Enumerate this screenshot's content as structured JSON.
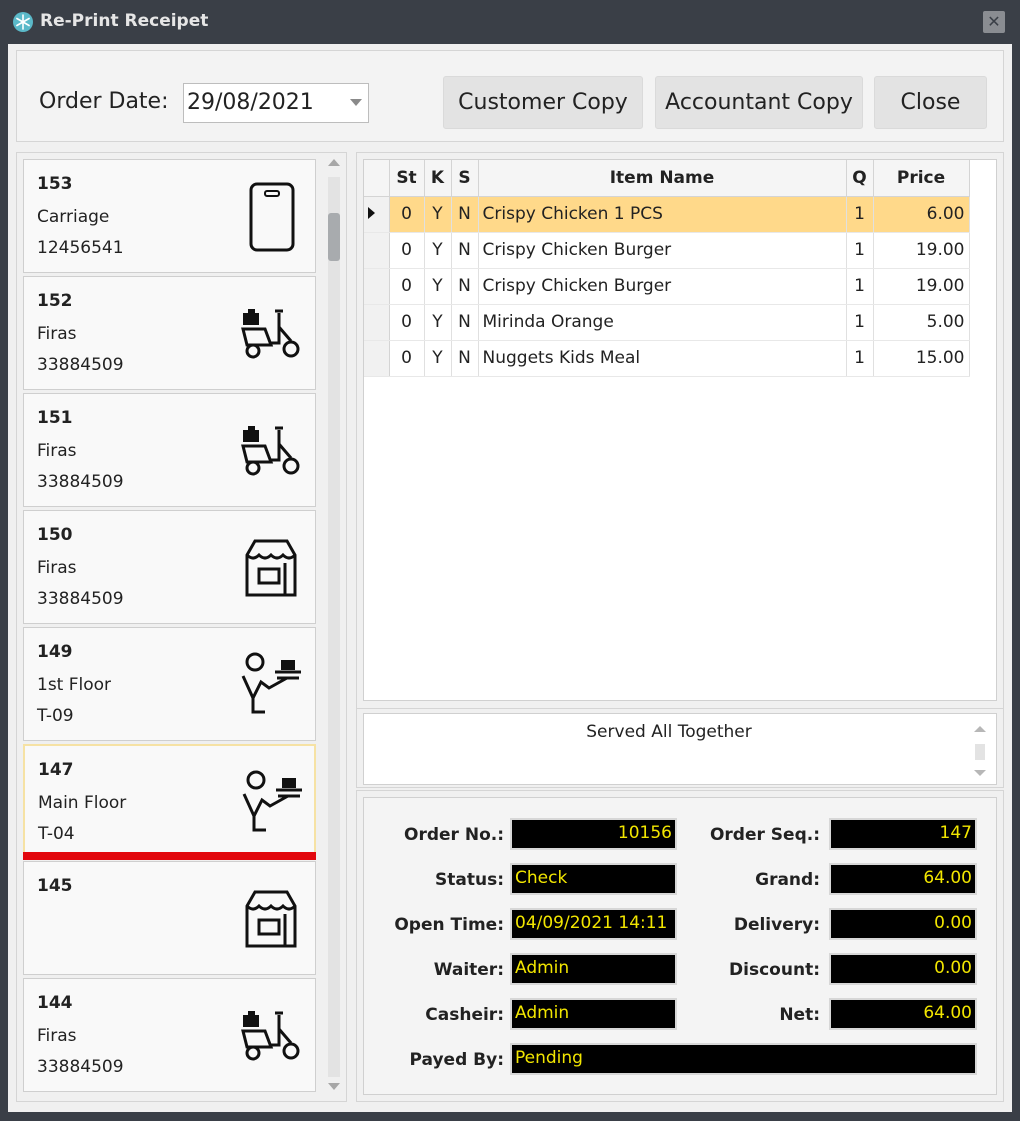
{
  "window": {
    "title": "Re-Print Receipet",
    "app_icon": "snowflake-icon",
    "close_glyph": "✕"
  },
  "toolbar": {
    "order_date_label": "Order Date:",
    "order_date_value": "29/08/2021",
    "customer_copy": "Customer Copy",
    "accountant_copy": "Accountant Copy",
    "close": "Close"
  },
  "orders": [
    {
      "number": "153",
      "line1": "Carriage",
      "line2": "12456541",
      "icon": "phone-icon"
    },
    {
      "number": "152",
      "line1": "Firas",
      "line2": "33884509",
      "icon": "delivery-scooter-icon"
    },
    {
      "number": "151",
      "line1": "Firas",
      "line2": "33884509",
      "icon": "delivery-scooter-icon"
    },
    {
      "number": "150",
      "line1": "Firas",
      "line2": "33884509",
      "icon": "takeaway-store-icon"
    },
    {
      "number": "149",
      "line1": "1st Floor",
      "line2": "T-09",
      "icon": "waiter-icon"
    },
    {
      "number": "147",
      "line1": "Main Floor",
      "line2": "T-04",
      "icon": "waiter-icon",
      "selected": true
    },
    {
      "number": "145",
      "line1": "",
      "line2": "",
      "icon": "takeaway-store-icon"
    },
    {
      "number": "144",
      "line1": "Firas",
      "line2": "33884509",
      "icon": "delivery-scooter-icon"
    }
  ],
  "items_grid": {
    "headers": {
      "st": "St",
      "k": "K",
      "s": "S",
      "name": "Item Name",
      "q": "Q",
      "price": "Price"
    },
    "rows": [
      {
        "st": "0",
        "k": "Y",
        "s": "N",
        "name": "Crispy Chicken 1 PCS",
        "q": "1",
        "price": "6.00"
      },
      {
        "st": "0",
        "k": "Y",
        "s": "N",
        "name": "Crispy Chicken Burger",
        "q": "1",
        "price": "19.00"
      },
      {
        "st": "0",
        "k": "Y",
        "s": "N",
        "name": "Crispy Chicken Burger",
        "q": "1",
        "price": "19.00"
      },
      {
        "st": "0",
        "k": "Y",
        "s": "N",
        "name": "Mirinda Orange",
        "q": "1",
        "price": "5.00"
      },
      {
        "st": "0",
        "k": "Y",
        "s": "N",
        "name": "Nuggets Kids Meal",
        "q": "1",
        "price": "15.00"
      }
    ],
    "active_row": 0
  },
  "note": "Served All Together",
  "details": {
    "order_no_label": "Order No.:",
    "order_no": "10156",
    "order_seq_label": "Order Seq.:",
    "order_seq": "147",
    "status_label": "Status:",
    "status": "Check",
    "grand_label": "Grand:",
    "grand": "64.00",
    "open_time_label": "Open Time:",
    "open_time": "04/09/2021 14:11",
    "delivery_label": "Delivery:",
    "delivery": "0.00",
    "waiter_label": "Waiter:",
    "waiter": "Admin",
    "discount_label": "Discount:",
    "discount": "0.00",
    "cashier_label": "Casheir:",
    "cashier": "Admin",
    "net_label": "Net:",
    "net": "64.00",
    "payed_by_label": "Payed By:",
    "payed_by": "Pending"
  },
  "colors": {
    "selected_row": "#ffd98a",
    "selection_bar": "#e2070d",
    "value_text": "#f2e600",
    "value_bg": "#000000"
  }
}
